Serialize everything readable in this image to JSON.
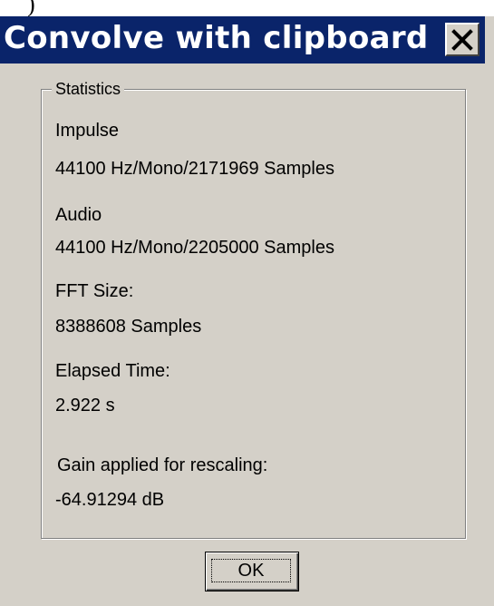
{
  "window": {
    "title": "Convolve with clipboard"
  },
  "icons": {
    "close": "close-icon"
  },
  "statistics": {
    "group_label": "Statistics",
    "impulse_label": "Impulse",
    "impulse_value": "44100 Hz/Mono/2171969 Samples",
    "audio_label": "Audio",
    "audio_value": "44100 Hz/Mono/2205000 Samples",
    "fft_label": "FFT Size:",
    "fft_value": "8388608 Samples",
    "elapsed_label": "Elapsed Time:",
    "elapsed_value": "2.922 s",
    "gain_label": "Gain applied for rescaling:",
    "gain_value": "-64.91294 dB"
  },
  "buttons": {
    "ok_label": "OK"
  },
  "colors": {
    "titlebar": "#0a246a",
    "face": "#d4d0c8"
  }
}
